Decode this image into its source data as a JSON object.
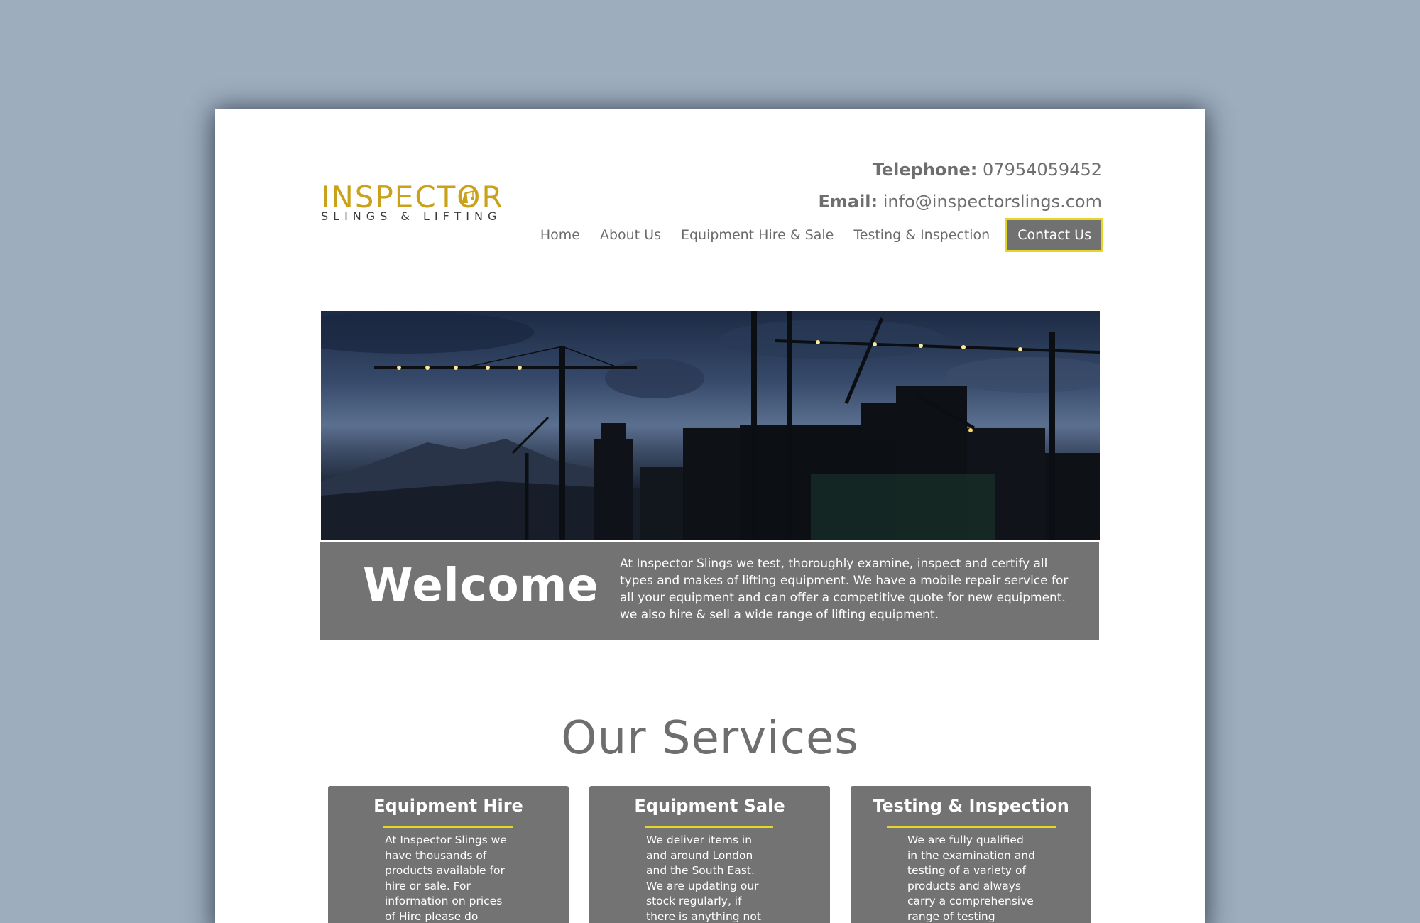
{
  "header": {
    "logo_main": "INSPECTOR",
    "logo_sub": "SLINGS & LIFTING",
    "phone_label": "Telephone:",
    "phone_value": "07954059452",
    "email_label": "Email:",
    "email_value": "info@inspectorslings.com"
  },
  "nav": {
    "items": [
      "Home",
      "About Us",
      "Equipment Hire & Sale",
      "Testing & Inspection",
      "Contact Us"
    ],
    "active_index": 4
  },
  "welcome": {
    "title": "Welcome",
    "text": "At Inspector Slings we test, thoroughly examine, inspect and certify all types and makes of lifting equipment. We have a mobile repair service for all your equipment and can offer a competitive quote for new equipment. we also hire & sell a wide range of lifting equipment."
  },
  "services": {
    "title": "Our Services",
    "cards": [
      {
        "title": "Equipment Hire",
        "text": "At Inspector Slings we have thousands of products available for hire or sale. For information on prices of Hire please do contact us"
      },
      {
        "title": "Equipment Sale",
        "text": "We deliver items in and around London and the South East. We are updating our stock regularly, if there is anything not advertised"
      },
      {
        "title": "Testing & Inspection",
        "text": "We are fully qualified in the examination and testing of a variety of products and always carry a comprehensive range of testing"
      }
    ]
  },
  "colors": {
    "background": "#9dadbd",
    "accent_gold": "#c9a21a",
    "accent_yellow": "#e6d62a",
    "panel_gray": "#737373",
    "text_gray": "#6e6e6e"
  },
  "icons": {
    "logo_mark": "crane-icon"
  }
}
